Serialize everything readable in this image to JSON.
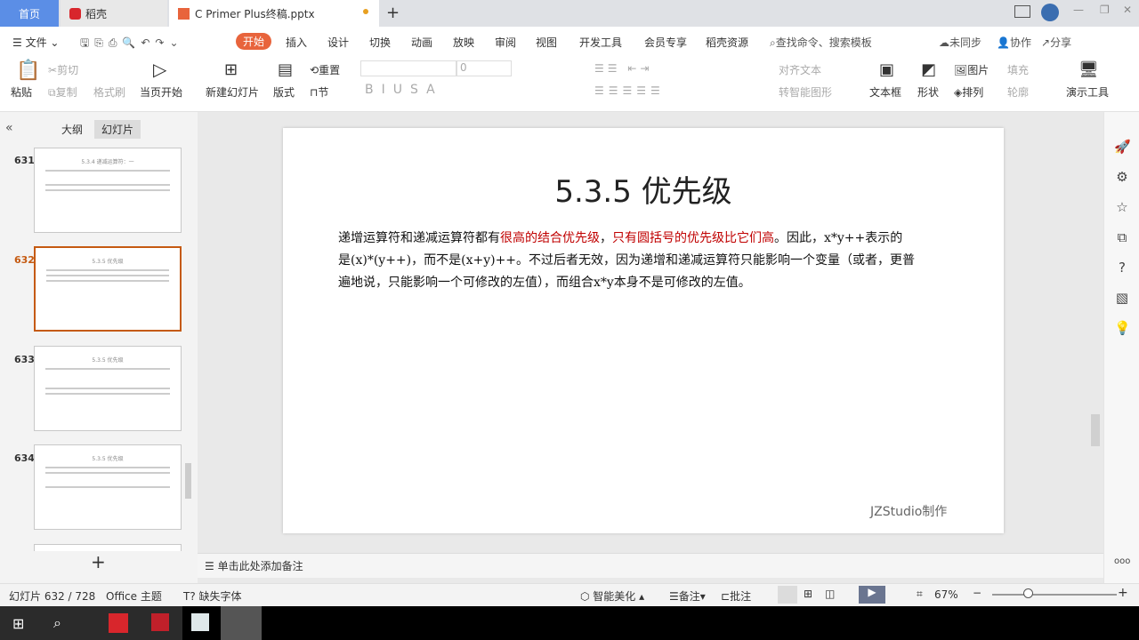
{
  "tabs": [
    {
      "label": "首页"
    },
    {
      "label": "稻壳"
    },
    {
      "label": "C Primer  Plus终稿.pptx"
    }
  ],
  "file_menu": "文件",
  "menus": [
    "开始",
    "插入",
    "设计",
    "切换",
    "动画",
    "放映",
    "审阅",
    "视图",
    "开发工具",
    "会员专享",
    "稻壳资源"
  ],
  "search_placeholder": "查找命令、搜索模板",
  "sync": "未同步",
  "collab": "协作",
  "share": "分享",
  "ribbon": {
    "paste": "粘贴",
    "cut": "剪切",
    "copy": "复制",
    "format_painter": "格式刷",
    "play_from_current": "当页开始",
    "new_slide": "新建幻灯片",
    "layout": "版式",
    "section": "节",
    "reset": "重置",
    "font_size": "0",
    "align_text": "对齐文本",
    "smart_art": "转智能图形",
    "textbox": "文本框",
    "shape": "形状",
    "picture": "图片",
    "fill": "填充",
    "arrange": "排列",
    "outline": "轮廓",
    "presentation_tools": "演示工具"
  },
  "panel": {
    "outline_tab": "大纲",
    "slides_tab": "幻灯片"
  },
  "thumbnails": [
    {
      "num": "631",
      "title": "5.3.4 递减运算符：一"
    },
    {
      "num": "632",
      "title": "5.3.5 优先级"
    },
    {
      "num": "633",
      "title": "5.3.5 优先级"
    },
    {
      "num": "634",
      "title": "5.3.5 优先级"
    }
  ],
  "slide": {
    "title": "5.3.5 优先级",
    "p1": "递增运算符和递减运算符都有",
    "p1_red1": "很高的结合优先级",
    "p1_comma": "，",
    "p1_red2": "只有圆括号的优先级比它们高",
    "p1_rest": "。因此，x*y++表示的",
    "p2": "是(x)*(y++)，而不是(x+y)++。不过后者无效，因为递增和递减运算符只能影响一个变量（或者，更普",
    "p3": "遍地说，只能影响一个可修改的左值），而组合x*y本身不是可修改的左值。",
    "watermark": "JZStudio制作"
  },
  "notes_placeholder": "单击此处添加备注",
  "status": {
    "slide_count": "幻灯片 632 / 728",
    "theme": "Office 主题",
    "missing_font": "缺失字体",
    "beautify": "智能美化",
    "notes": "备注",
    "comments": "批注",
    "zoom": "67%"
  },
  "colors": {
    "accent": "#e8643c",
    "selected": "#c55a11",
    "highlight": "#c00000"
  }
}
